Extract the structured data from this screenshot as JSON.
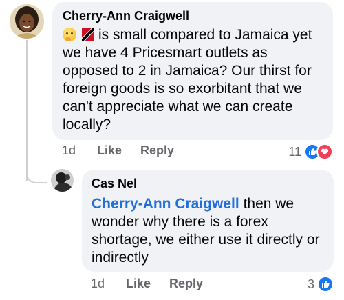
{
  "comment": {
    "author": "Cherry-Ann Craigwell",
    "emoji": "thinking-face-emoji",
    "flag": "trinidad-tobago-flag",
    "text": "is small compared to Jamaica yet we have 4 Pricesmart outlets as opposed to 2 in Jamaica? Our thirst for foreign goods is so exorbitant that we can't appreciate what we can create locally?",
    "time": "1d",
    "like_label": "Like",
    "reply_label": "Reply",
    "reaction_count": "11",
    "reactions": [
      "like-icon",
      "love-icon"
    ]
  },
  "reply": {
    "author": "Cas Nel",
    "mention": "Cherry-Ann Craigwell",
    "text": "then we wonder why there is a forex shortage, we either use it directly or indirectly",
    "time": "1d",
    "like_label": "Like",
    "reply_label": "Reply",
    "reaction_count": "3",
    "reactions": [
      "like-icon"
    ]
  },
  "colors": {
    "bubble": "#f0f2f5",
    "mention": "#216fdb",
    "like": "#1877f2",
    "love": "#f33e58",
    "meta": "#65676b"
  }
}
